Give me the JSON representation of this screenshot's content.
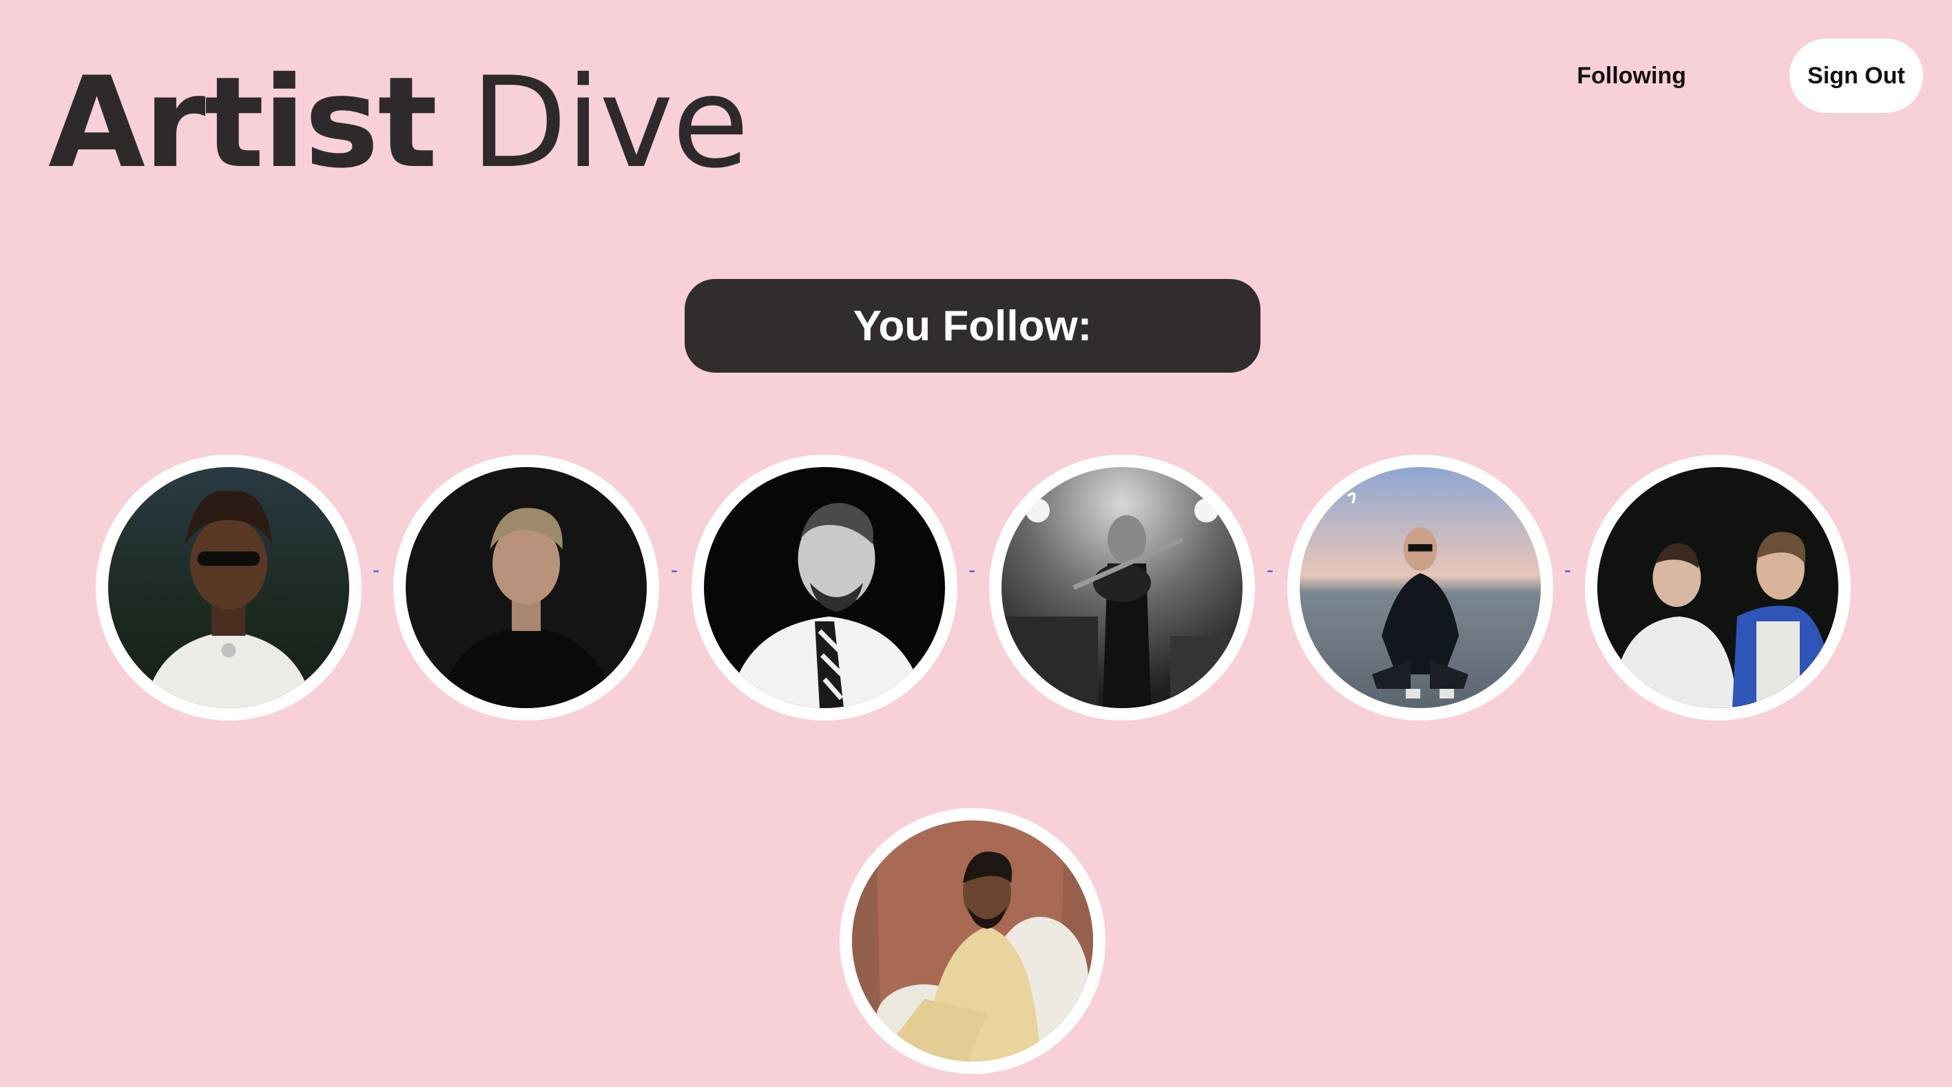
{
  "header": {
    "logo_bold": "Artist",
    "logo_light": "Dive",
    "nav_following": "Following",
    "nav_sign_out": "Sign Out"
  },
  "main": {
    "section_title": "You Follow:",
    "separator": "-",
    "artists_count_shown": 7
  },
  "colors": {
    "background": "#f8d0d8",
    "title_bar": "#312c2d",
    "avatar_ring": "#ffffff",
    "separator": "#4455dd"
  }
}
